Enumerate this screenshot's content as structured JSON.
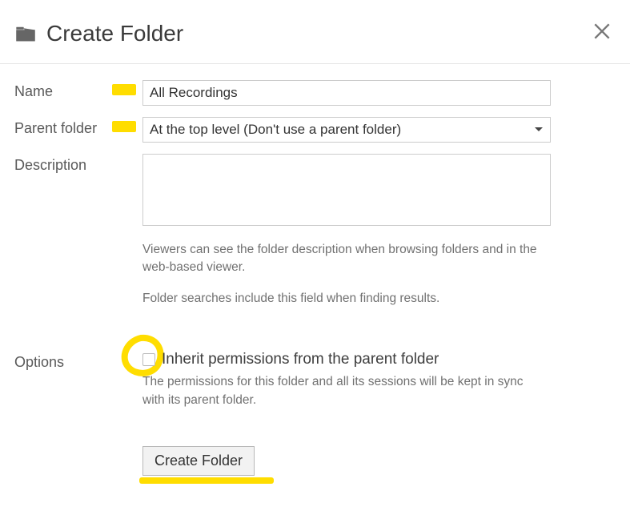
{
  "header": {
    "title": "Create Folder"
  },
  "form": {
    "name": {
      "label": "Name",
      "value": "All Recordings"
    },
    "parent": {
      "label": "Parent folder",
      "selected": "At the top level (Don't use a parent folder)"
    },
    "description": {
      "label": "Description",
      "value": "",
      "help1": "Viewers can see the folder description when browsing folders and in the web-based viewer.",
      "help2": "Folder searches include this field when finding results."
    },
    "options": {
      "label": "Options",
      "inherit": {
        "label": "Inherit permissions from the parent folder",
        "help": "The permissions for this folder and all its sessions will be kept in sync with its parent folder."
      }
    },
    "submit": {
      "label": "Create Folder"
    }
  },
  "colors": {
    "highlight": "#ffdd00"
  }
}
